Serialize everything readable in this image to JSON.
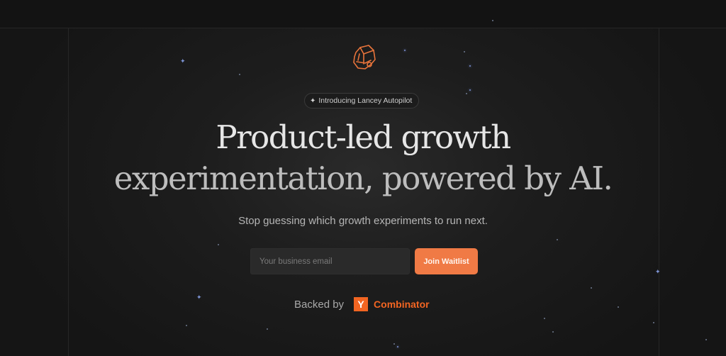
{
  "colors": {
    "background": "#141414",
    "accent": "#f07a45",
    "yc_orange": "#f26522",
    "headline": "#e6e6e6",
    "star_blue": "#7d93d6"
  },
  "hero": {
    "logo_icon": "knight-helmet-icon",
    "badge": {
      "icon": "sparkle-icon",
      "text": "Introducing Lancey Autopilot"
    },
    "headline_line1": "Product-led growth",
    "headline_line2": "experimentation, powered by AI.",
    "subtitle": "Stop guessing which growth experiments to run next."
  },
  "waitlist": {
    "email_placeholder": "Your business email",
    "email_value": "",
    "button_label": "Join Waitlist"
  },
  "backed_by": {
    "label": "Backed by",
    "logo_letter": "Y",
    "name": "Combinator"
  }
}
